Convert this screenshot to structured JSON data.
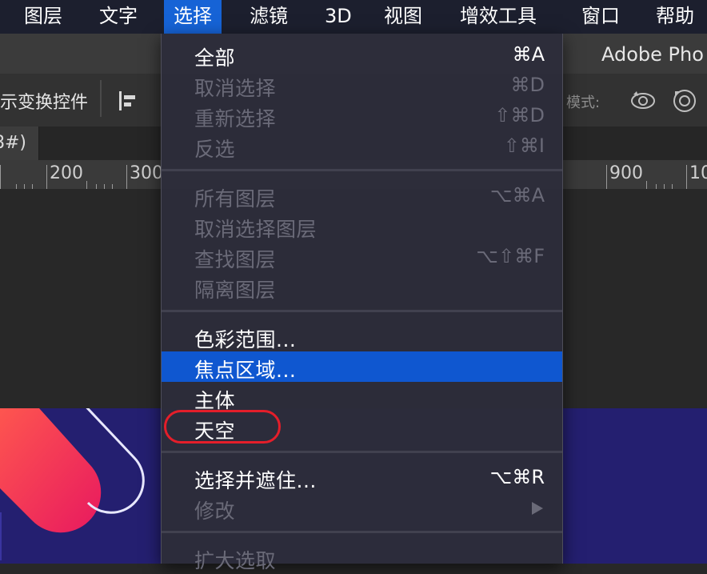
{
  "menubar": {
    "items": [
      "图层",
      "文字",
      "选择",
      "滤镜",
      "3D",
      "视图",
      "增效工具",
      "窗口",
      "帮助"
    ],
    "active_index": 2
  },
  "app_title": "Adobe Pho",
  "options_bar": {
    "transform_label": "示变换控件",
    "mode_label": "模式:"
  },
  "doc_tab": {
    "label": "8#)"
  },
  "ruler": {
    "labels": [
      "200",
      "300",
      "900",
      "10"
    ]
  },
  "dropdown": {
    "groups": [
      [
        {
          "label": "全部",
          "shortcut": "⌘A",
          "enabled": true
        },
        {
          "label": "取消选择",
          "shortcut": "⌘D",
          "enabled": false
        },
        {
          "label": "重新选择",
          "shortcut": "⇧⌘D",
          "enabled": false
        },
        {
          "label": "反选",
          "shortcut": "⇧⌘I",
          "enabled": false
        }
      ],
      [
        {
          "label": "所有图层",
          "shortcut": "⌥⌘A",
          "enabled": false
        },
        {
          "label": "取消选择图层",
          "shortcut": "",
          "enabled": false
        },
        {
          "label": "查找图层",
          "shortcut": "⌥⇧⌘F",
          "enabled": false
        },
        {
          "label": "隔离图层",
          "shortcut": "",
          "enabled": false
        }
      ],
      [
        {
          "label": "色彩范围...",
          "shortcut": "",
          "enabled": true
        },
        {
          "label": "焦点区域...",
          "shortcut": "",
          "enabled": true,
          "highlighted": true
        },
        {
          "label": "主体",
          "shortcut": "",
          "enabled": true
        },
        {
          "label": "天空",
          "shortcut": "",
          "enabled": true,
          "annotated": true
        }
      ],
      [
        {
          "label": "选择并遮住...",
          "shortcut": "⌥⌘R",
          "enabled": true
        },
        {
          "label": "修改",
          "shortcut": "",
          "enabled": false,
          "submenu": true
        }
      ],
      [
        {
          "label": "扩大选取",
          "shortcut": "",
          "enabled": false
        }
      ]
    ]
  },
  "colors": {
    "menubar_bg": "#1c1f2e",
    "active_menu": "#1663d6",
    "highlight": "#0f57d0",
    "annotation": "#e41e2a",
    "disabled_text": "#6a6a78",
    "artwork_bg": "#241f70"
  }
}
